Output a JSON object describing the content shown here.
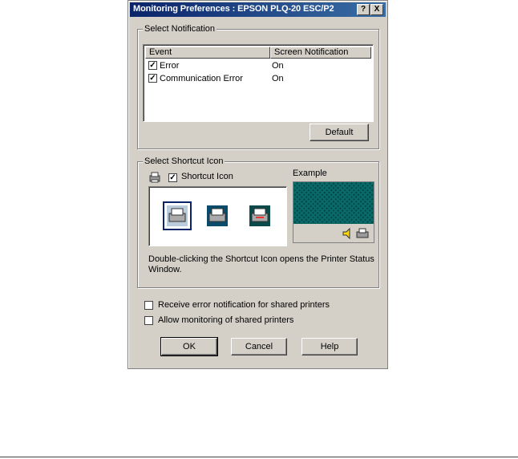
{
  "window": {
    "title": "Monitoring Preferences : EPSON PLQ-20 ESC/P2",
    "help_btn": "?",
    "close_btn": "X"
  },
  "notification": {
    "group_label": "Select Notification",
    "columns": [
      "Event",
      "Screen Notification"
    ],
    "rows": [
      {
        "event": "Error",
        "value": "On",
        "checked": true
      },
      {
        "event": "Communication Error",
        "value": "On",
        "checked": true
      }
    ],
    "default_button": "Default"
  },
  "shortcut": {
    "group_label": "Select Shortcut Icon",
    "checkbox_label": "Shortcut Icon",
    "checked": true,
    "example_label": "Example",
    "description": "Double-clicking the Shortcut Icon opens the Printer Status Window.",
    "description_line1": "Double-clicking the Shortcut Icon opens the Printer Status",
    "description_line2": "Window."
  },
  "options": {
    "shared_error": "Receive error notification for shared printers",
    "shared_monitor": "Allow monitoring of shared printers"
  },
  "buttons": {
    "ok": "OK",
    "cancel": "Cancel",
    "help": "Help"
  },
  "colors": {
    "titlebar_start": "#0a246a",
    "titlebar_end": "#3a6ea5",
    "example_bg": "#005a5a"
  }
}
